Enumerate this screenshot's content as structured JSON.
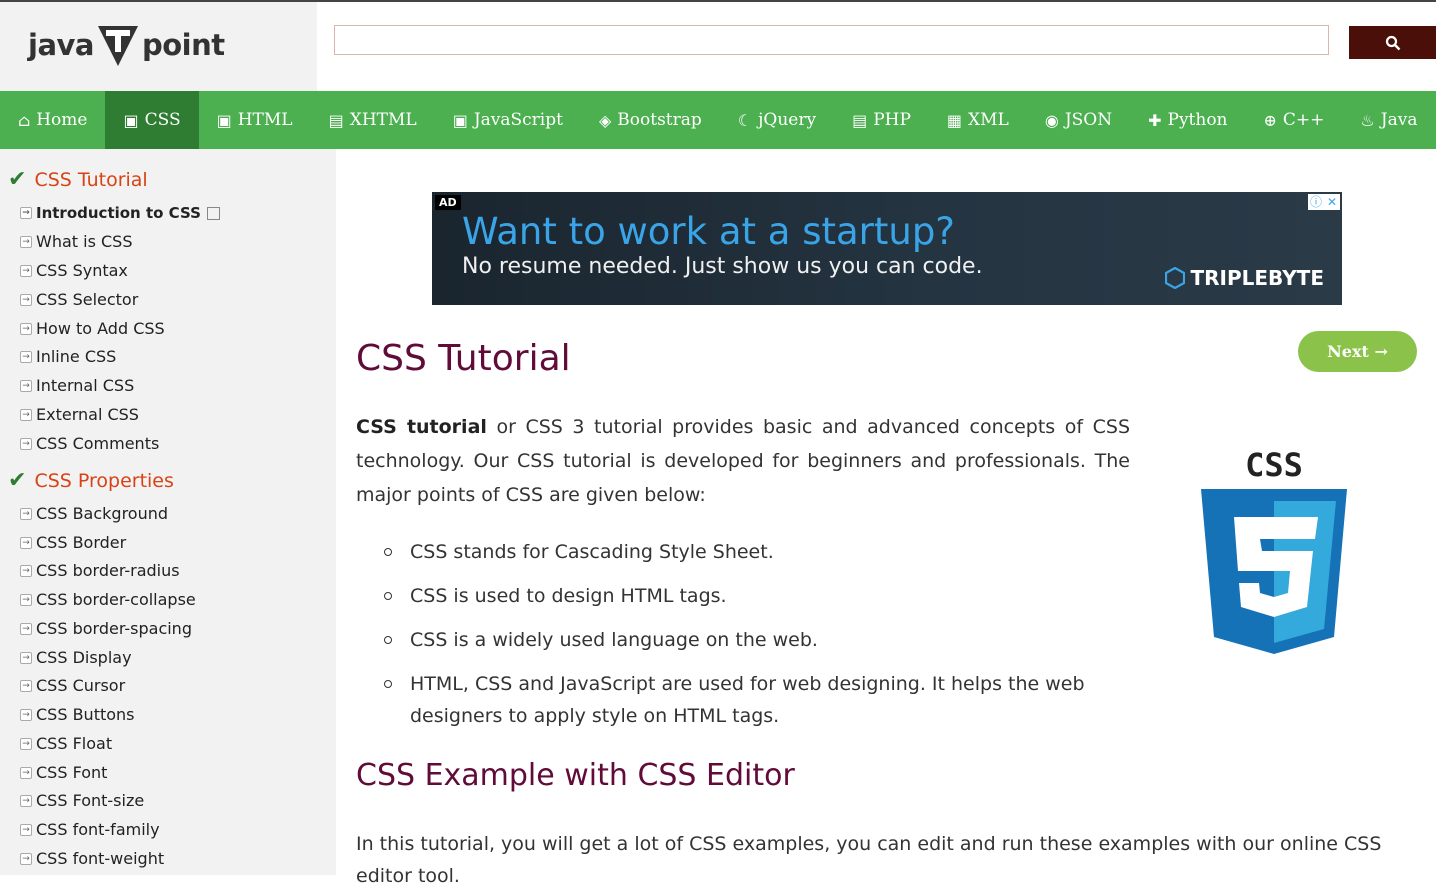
{
  "header": {
    "logo_left": "java",
    "logo_right": "point",
    "search_placeholder": ""
  },
  "nav": {
    "items": [
      {
        "label": "Home",
        "icon": "home-icon"
      },
      {
        "label": "CSS",
        "icon": "css3-icon"
      },
      {
        "label": "HTML",
        "icon": "html5-icon"
      },
      {
        "label": "XHTML",
        "icon": "print-icon"
      },
      {
        "label": "JavaScript",
        "icon": "js-icon"
      },
      {
        "label": "Bootstrap",
        "icon": "bootstrap-icon"
      },
      {
        "label": "jQuery",
        "icon": "jquery-icon"
      },
      {
        "label": "PHP",
        "icon": "php-icon"
      },
      {
        "label": "XML",
        "icon": "xml-icon"
      },
      {
        "label": "JSON",
        "icon": "json-icon"
      },
      {
        "label": "Python",
        "icon": "python-icon"
      },
      {
        "label": "C++",
        "icon": "cpp-icon"
      },
      {
        "label": "Java",
        "icon": "java-icon"
      }
    ]
  },
  "sidebar": {
    "section1_title": "CSS Tutorial",
    "section1_links": [
      "Introduction to CSS",
      "What is CSS",
      "CSS Syntax",
      "CSS Selector",
      "How to Add CSS",
      "Inline CSS",
      "Internal CSS",
      "External CSS",
      "CSS Comments"
    ],
    "section2_title": "CSS Properties",
    "section2_links": [
      "CSS Background",
      "CSS Border",
      "CSS border-radius",
      "CSS border-collapse",
      "CSS border-spacing",
      "CSS Display",
      "CSS Cursor",
      "CSS Buttons",
      "CSS Float",
      "CSS Font",
      "CSS Font-size",
      "CSS font-family",
      "CSS font-weight"
    ]
  },
  "ad": {
    "label": "AD",
    "headline": "Want to work at a startup?",
    "subline": "No resume needed. Just show us you can code.",
    "brand": "TRIPLEBYTE"
  },
  "main": {
    "title": "CSS Tutorial",
    "next_label": "Next →",
    "intro_bold": "CSS tutorial",
    "intro_rest": " or CSS 3 tutorial provides basic and advanced concepts of CSS technology. Our CSS tutorial is developed for beginners and professionals. The major points of CSS are given below:",
    "points": [
      "CSS stands for Cascading Style Sheet.",
      "CSS is used to design HTML tags.",
      "CSS is a widely used language on the web.",
      "HTML, CSS and JavaScript are used for web designing. It helps the web designers to apply style on HTML tags."
    ],
    "logo_text": "CSS",
    "subtitle": "CSS Example with CSS Editor",
    "para2": "In this tutorial, you will get a lot of CSS examples, you can edit and run these examples with our online CSS editor tool."
  },
  "colors": {
    "nav_bg": "#4caf50",
    "nav_active": "#2e7d32",
    "title": "#610b38",
    "sidebar_head": "#d84315",
    "next_btn": "#8bc34a",
    "search_btn": "#4b0f0a"
  }
}
